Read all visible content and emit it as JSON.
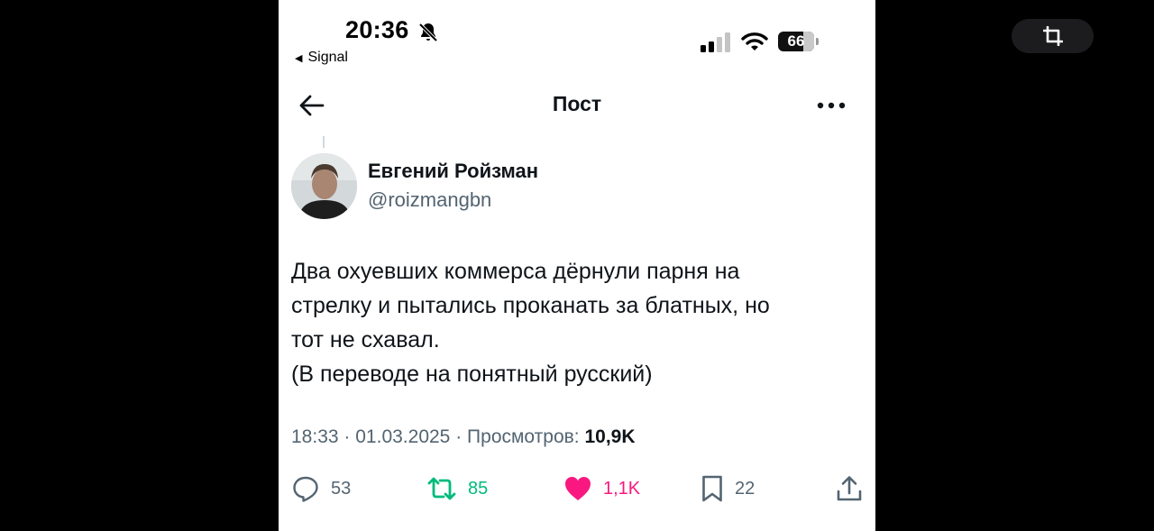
{
  "status_bar": {
    "time": "20:36",
    "back_app": "Signal",
    "battery": "66"
  },
  "nav": {
    "title": "Пост"
  },
  "author": {
    "name": "Евгений Ройзман",
    "handle": "@roizmangbn"
  },
  "tweet": {
    "lines": [
      "Два охуевших коммерса дёрнули парня на",
      "стрелку и пытались проканать за блатных, но",
      "тот не схавал.",
      "(В переводе на понятный русский)"
    ]
  },
  "meta": {
    "time": "18:33",
    "sep": "·",
    "date": "01.03.2025",
    "views_label": "Просмотров:",
    "views": "10,9K"
  },
  "actions": {
    "replies": "53",
    "retweets": "85",
    "likes": "1,1K",
    "bookmarks": "22"
  },
  "colors": {
    "retweet": "#00ba7c",
    "like": "#f91880",
    "secondary_text": "#536471",
    "primary_text": "#0f1419"
  },
  "icons": [
    "bell-slash-icon",
    "signal-icon",
    "wifi-icon",
    "battery-icon",
    "back-arrow-icon",
    "more-icon",
    "reply-icon",
    "retweet-icon",
    "heart-icon",
    "bookmark-icon",
    "share-icon",
    "crop-icon"
  ]
}
